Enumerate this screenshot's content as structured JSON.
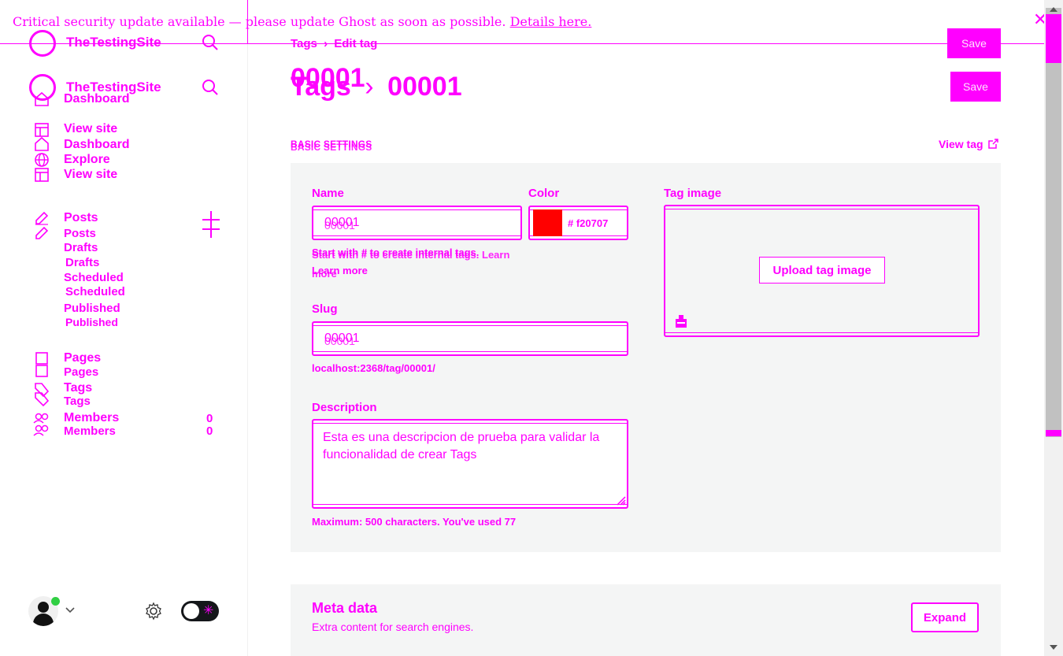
{
  "banner": {
    "message": "Critical security update available — please update Ghost as soon as possible.",
    "link": "Details here.",
    "close": "✕"
  },
  "sidebar": {
    "site_name": "TheTestingSite",
    "nav_top": [
      {
        "label": "Dashboard",
        "icon": "home-icon"
      },
      {
        "label": "View site",
        "icon": "window-icon"
      },
      {
        "label": "Dashboard",
        "icon": "home-icon"
      },
      {
        "label": "Explore",
        "icon": "globe-icon"
      },
      {
        "label": "View site",
        "icon": "window-icon"
      }
    ],
    "posts": {
      "label": "Posts",
      "add": "+"
    },
    "posts_sub": [
      "Posts",
      "Drafts",
      "Drafts",
      "Scheduled",
      "Scheduled",
      "Published",
      "Published"
    ],
    "pages": [
      "Pages",
      "Pages"
    ],
    "tags": [
      "Tags",
      "Tags"
    ],
    "members": [
      {
        "label": "Members",
        "count": "0"
      },
      {
        "label": "Members",
        "count": "0"
      }
    ]
  },
  "header": {
    "breadcrumb_parent": "Tags",
    "breadcrumb_sep": "›",
    "breadcrumb_current": "Edit tag",
    "title_ghost": "00001",
    "title_parent": "Tags",
    "title_sep": "›",
    "title": "00001",
    "save": "Save"
  },
  "section": {
    "caption": "BASIC SETTINGS",
    "view_tag": "View tag"
  },
  "form": {
    "name_label": "Name",
    "name_value": "00001",
    "name_hint": "Start with # to create internal tags.",
    "name_hint_learn": "Learn more",
    "name_hint_ghost": "Start with # to create internal tags. Learn",
    "name_hint_ghost2": "more",
    "color_label": "Color",
    "color_swatch": "#ff0000",
    "color_value": "# f20707",
    "slug_label": "Slug",
    "slug_value": "00001",
    "slug_hint": "localhost:2368/tag/00001/",
    "desc_label": "Description",
    "desc_value": "Esta es una descripcion de prueba para validar la funcionalidad de crear Tags",
    "desc_hint": "Maximum: 500 characters. You've used 77",
    "image_label": "Tag image",
    "image_button": "Upload tag image"
  },
  "meta": {
    "title": "Meta data",
    "subtitle": "Extra content for search engines.",
    "expand": "Expand"
  },
  "colors": {
    "accent": "#ff00ff",
    "online": "#30cf43"
  }
}
